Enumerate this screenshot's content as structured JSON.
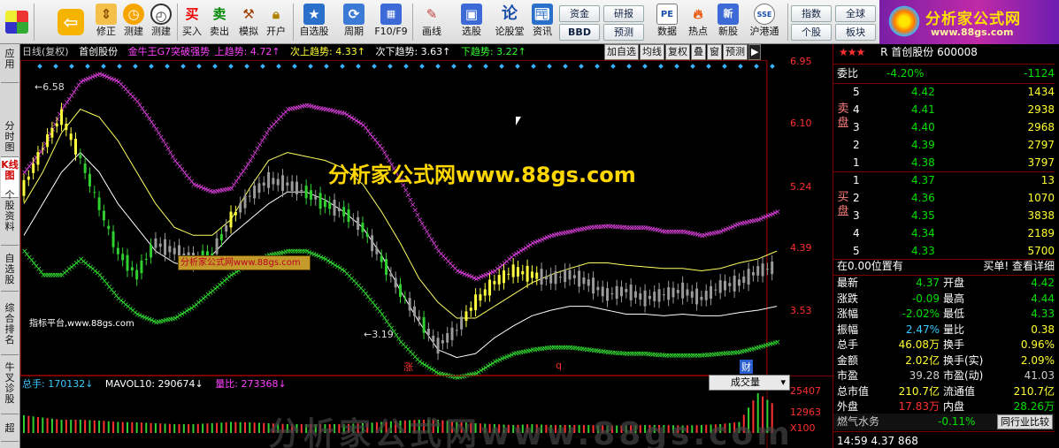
{
  "toolbar": {
    "buttons": [
      {
        "label": "修正",
        "icon": "up-down-arrows-icon"
      },
      {
        "label": "测建",
        "icon": "clock-icon"
      },
      {
        "label": "测建",
        "icon": "alarm-clock-icon"
      },
      {
        "label": "买入",
        "icon": "buy-icon",
        "glyph": "买"
      },
      {
        "label": "卖出",
        "icon": "sell-icon",
        "glyph": "卖"
      },
      {
        "label": "模拟",
        "icon": "hammer-icon"
      },
      {
        "label": "开户",
        "icon": "lock-icon"
      },
      {
        "label": "自选股",
        "icon": "star-folder-icon"
      },
      {
        "label": "周期",
        "icon": "period-icon"
      },
      {
        "label": "F10/F9",
        "icon": "f10-icon"
      },
      {
        "label": "画线",
        "icon": "pen-icon"
      },
      {
        "label": "选股",
        "icon": "screen-icon"
      },
      {
        "label": "论股堂",
        "icon": "forum-icon",
        "glyph": "论"
      },
      {
        "label": "资讯",
        "icon": "news-icon"
      },
      {
        "label": "数据",
        "icon": "pe-icon",
        "glyph": "PE"
      },
      {
        "label": "热点",
        "icon": "fire-icon"
      },
      {
        "label": "新股",
        "icon": "new-stock-icon"
      },
      {
        "label": "沪港通",
        "icon": "hk-icon",
        "glyph": "SSE"
      }
    ],
    "small_buttons": [
      "资金",
      "BBD",
      "研报",
      "预测",
      "指数",
      "个股",
      "全球",
      "板块"
    ],
    "logo_title": "分析家公式网",
    "logo_url": "www.88gs.com"
  },
  "vtabs": [
    "应用",
    "分时图",
    "K线图",
    "个股资料",
    "自选股",
    "综合排名",
    "牛叉诊股",
    "超"
  ],
  "chart": {
    "title_items": [
      {
        "text": "日线(复权)",
        "color": "#cccccc"
      },
      {
        "text": "首创股份",
        "color": "#ffffff"
      },
      {
        "text": "金牛王G7突破强势",
        "color": "#ff40ff"
      },
      {
        "text": "上趋势: 4.72↑",
        "color": "#ff40ff"
      },
      {
        "text": "次上趋势: 4.33↑",
        "color": "#ffff30"
      },
      {
        "text": "次下趋势: 3.63↑",
        "color": "#ffffff"
      },
      {
        "text": "下趋势: 3.22↑",
        "color": "#30ff30"
      }
    ],
    "period_buttons": [
      "加自选",
      "均线",
      "复权",
      "叠",
      "窗",
      "预测",
      "▶"
    ],
    "price_ticks": [
      "6.95",
      "6.10",
      "5.24",
      "4.39",
      "3.53"
    ],
    "high_label": "6.58",
    "low_label": "3.19",
    "watermark": "分析家公式网www.88gs.com",
    "watermark_box": "分析家公式网www.88gs.com",
    "platform": "指标平台,www.88gs.com",
    "event_labels": [
      "涨",
      "q",
      "财"
    ],
    "vol_bar": {
      "label1": "总手: 170132↓",
      "label2": "MAVOL10: 290674↓",
      "label3": "量比: 273368↓",
      "select": "成交量"
    },
    "vol_ticks": [
      "25407",
      "12963",
      "X100"
    ],
    "big_watermark": "分析家公式网www.88gs.com"
  },
  "chart_data": {
    "type": "candlestick",
    "title": "",
    "ylim": [
      3.1,
      7.0
    ],
    "series": [
      {
        "name": "上趋势",
        "values": [
          5.6,
          5.9,
          6.4,
          6.75,
          6.85,
          6.75,
          6.5,
          6.15,
          5.75,
          5.45,
          5.35,
          5.4,
          5.75,
          6.15,
          6.4,
          6.45,
          6.4,
          6.35,
          6.2,
          5.9,
          5.5,
          5.0,
          4.6,
          4.35,
          4.25,
          4.35,
          4.55,
          4.7,
          4.8,
          4.85,
          4.9,
          4.92,
          4.9,
          4.9,
          4.85,
          4.85,
          4.8,
          4.85,
          4.95,
          5.0,
          5.1
        ]
      },
      {
        "name": "次上趋势",
        "values": [
          5.2,
          5.6,
          6.1,
          6.4,
          6.3,
          6.0,
          5.6,
          5.2,
          4.9,
          4.8,
          4.8,
          5.0,
          5.4,
          5.75,
          5.85,
          5.8,
          5.75,
          5.65,
          5.45,
          5.1,
          4.7,
          4.25,
          3.95,
          3.75,
          3.75,
          3.9,
          4.05,
          4.2,
          4.3,
          4.38,
          4.45,
          4.45,
          4.42,
          4.4,
          4.38,
          4.38,
          4.35,
          4.38,
          4.45,
          4.5,
          4.6
        ]
      },
      {
        "name": "次下趋势",
        "values": [
          4.8,
          5.2,
          5.6,
          5.85,
          5.6,
          5.2,
          4.9,
          4.6,
          4.45,
          4.4,
          4.55,
          4.8,
          5.0,
          5.2,
          5.35,
          5.35,
          5.25,
          5.1,
          4.9,
          4.55,
          4.1,
          3.7,
          3.35,
          3.25,
          3.3,
          3.5,
          3.65,
          3.78,
          3.85,
          3.9,
          3.9,
          3.85,
          3.8,
          3.8,
          3.78,
          3.8,
          3.78,
          3.78,
          3.82,
          3.85,
          3.9
        ]
      },
      {
        "name": "下趋势",
        "values": [
          4.6,
          4.3,
          4.3,
          4.5,
          4.3,
          4.0,
          3.8,
          3.7,
          3.75,
          3.9,
          4.1,
          4.3,
          4.45,
          4.55,
          4.6,
          4.6,
          4.5,
          4.35,
          4.1,
          3.8,
          3.45,
          3.2,
          3.05,
          3.0,
          3.05,
          3.2,
          3.3,
          3.35,
          3.38,
          3.38,
          3.35,
          3.32,
          3.3,
          3.3,
          3.28,
          3.28,
          3.28,
          3.3,
          3.32,
          3.38,
          3.45
        ]
      }
    ],
    "closes": [
      5.4,
      5.9,
      6.3,
      5.8,
      5.2,
      4.6,
      4.3,
      4.7,
      4.6,
      4.5,
      4.55,
      5.0,
      5.3,
      5.5,
      5.45,
      5.35,
      5.2,
      5.1,
      4.9,
      4.5,
      4.1,
      3.75,
      3.4,
      3.6,
      3.95,
      4.2,
      4.35,
      4.3,
      4.25,
      4.3,
      4.2,
      4.05,
      4.1,
      4.0,
      4.05,
      4.1,
      4.0,
      4.15,
      4.2,
      4.35,
      4.4
    ],
    "volumes": [
      0.4,
      0.35,
      0.3,
      0.3,
      0.28,
      0.25,
      0.24,
      0.22,
      0.2,
      0.2,
      0.22,
      0.25,
      0.24,
      0.22,
      0.2,
      0.2,
      0.2,
      0.2,
      0.22,
      0.25,
      0.28,
      0.3,
      0.3,
      0.25,
      0.22,
      0.2,
      0.18,
      0.2,
      0.18,
      0.18,
      0.18,
      0.17,
      0.17,
      0.18,
      0.18,
      0.17,
      0.18,
      0.2,
      0.25,
      0.9,
      0.6
    ],
    "high": 6.58,
    "low": 3.19
  },
  "quote": {
    "stars": "★★★",
    "name": "R 首创股份 600008",
    "weibi_label": "委比",
    "weibi_pct": "-4.20%",
    "weibi_val": "-1124",
    "sell_label": "卖盘",
    "buy_label": "买盘",
    "sell": [
      {
        "lvl": "5",
        "price": "4.42",
        "vol": "1434"
      },
      {
        "lvl": "4",
        "price": "4.41",
        "vol": "2938"
      },
      {
        "lvl": "3",
        "price": "4.40",
        "vol": "2968"
      },
      {
        "lvl": "2",
        "price": "4.39",
        "vol": "2797"
      },
      {
        "lvl": "1",
        "price": "4.38",
        "vol": "3797"
      }
    ],
    "buy": [
      {
        "lvl": "1",
        "price": "4.37",
        "vol": "13"
      },
      {
        "lvl": "2",
        "price": "4.36",
        "vol": "1070"
      },
      {
        "lvl": "3",
        "price": "4.35",
        "vol": "3838"
      },
      {
        "lvl": "4",
        "price": "4.34",
        "vol": "2189"
      },
      {
        "lvl": "5",
        "price": "4.33",
        "vol": "5700"
      }
    ],
    "position_text": "在0.00位置有",
    "detail_text": "买单! 查看详细",
    "stats": [
      {
        "l1": "最新",
        "v1": "4.37",
        "c1": "green",
        "l2": "开盘",
        "v2": "4.42",
        "c2": "green"
      },
      {
        "l1": "涨跌",
        "v1": "-0.09",
        "c1": "green",
        "l2": "最高",
        "v2": "4.44",
        "c2": "green"
      },
      {
        "l1": "涨幅",
        "v1": "-2.02%",
        "c1": "green",
        "l2": "最低",
        "v2": "4.33",
        "c2": "green"
      },
      {
        "l1": "振幅",
        "v1": "2.47%",
        "c1": "cyan",
        "l2": "量比",
        "v2": "0.38",
        "c2": "yellow"
      },
      {
        "l1": "总手",
        "v1": "46.08万",
        "c1": "yellow",
        "l2": "换手",
        "v2": "0.96%",
        "c2": "yellow"
      },
      {
        "l1": "金额",
        "v1": "2.02亿",
        "c1": "yellow",
        "l2": "换手(实)",
        "v2": "2.09%",
        "c2": "yellow"
      },
      {
        "l1": "市盈",
        "v1": "39.28",
        "c1": "gray",
        "l2": "市盈(动)",
        "v2": "41.03",
        "c2": "gray"
      },
      {
        "l1": "总市值",
        "v1": "210.7亿",
        "c1": "yellow",
        "l2": "流通值",
        "v2": "210.7亿",
        "c2": "yellow"
      },
      {
        "l1": "外盘",
        "v1": "17.83万",
        "c1": "red",
        "l2": "内盘",
        "v2": "28.26万",
        "c2": "green"
      }
    ],
    "sector_name": "燃气水务",
    "sector_pct": "-0.11%",
    "compare_btn": "同行业比较",
    "last_row": "14:59    4.37    868"
  }
}
